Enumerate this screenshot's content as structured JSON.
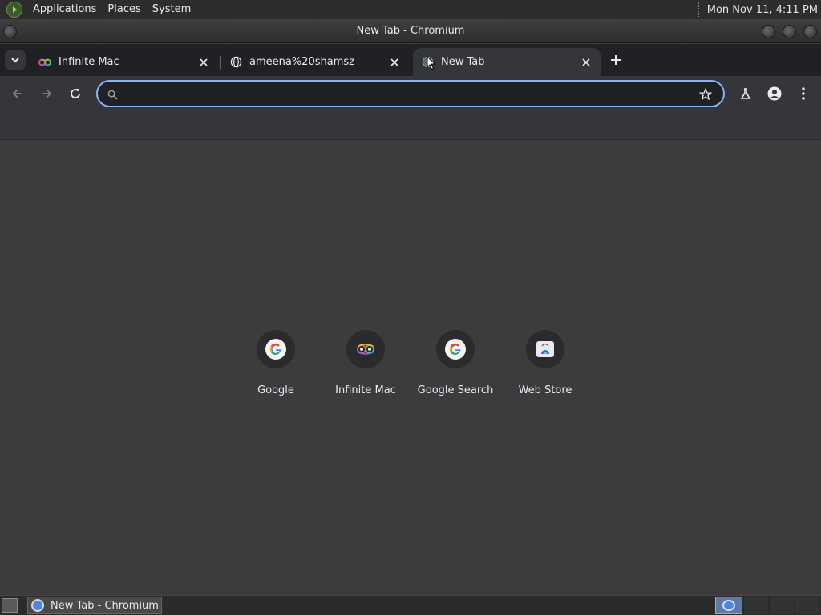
{
  "top_panel": {
    "menus": [
      "Applications",
      "Places",
      "System"
    ],
    "clock": "Mon Nov 11,  4:11 PM"
  },
  "window": {
    "title": "New Tab - Chromium"
  },
  "tabs": [
    {
      "title": "Infinite Mac",
      "favicon": "rainbow-infinity-icon",
      "active": false
    },
    {
      "title": "ameena%20shamsz",
      "favicon": "globe-icon",
      "active": false
    },
    {
      "title": "New Tab",
      "favicon": "loading-globe-icon",
      "active": true
    }
  ],
  "omnibox": {
    "value": "",
    "placeholder": ""
  },
  "shortcuts": [
    {
      "label": "Google",
      "icon": "google-g-icon"
    },
    {
      "label": "Infinite Mac",
      "icon": "infinite-mac-icon"
    },
    {
      "label": "Google Search",
      "icon": "google-g-icon"
    },
    {
      "label": "Web Store",
      "icon": "web-store-icon"
    }
  ],
  "taskbar": {
    "items": [
      {
        "label": "New Tab - Chromium",
        "icon": "chromium-icon"
      }
    ]
  },
  "colors": {
    "accent": "#8ab4f8",
    "tabstrip_bg": "#202124",
    "toolbar_bg": "#35363a",
    "content_bg": "#3c3c3e"
  }
}
